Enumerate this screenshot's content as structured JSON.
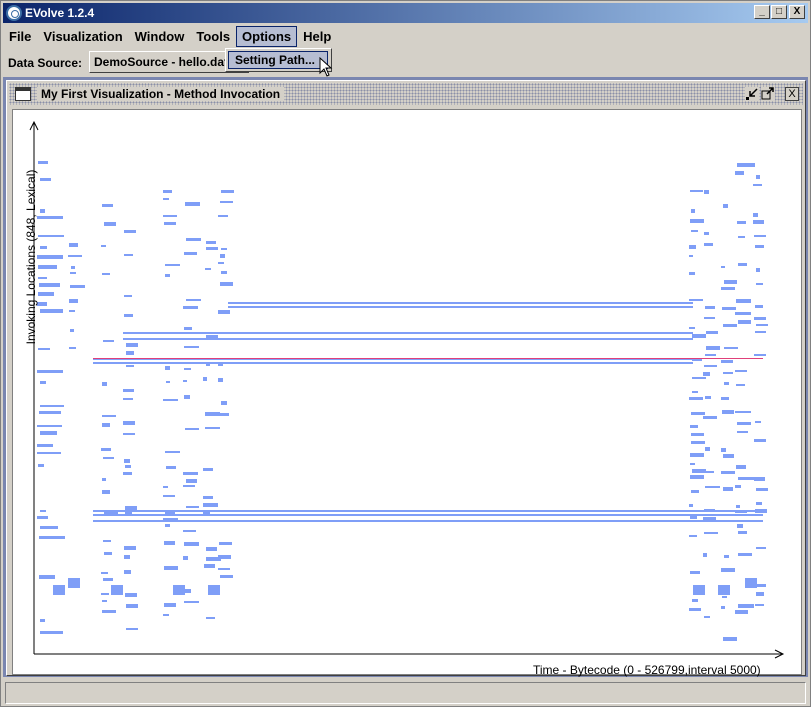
{
  "window": {
    "title": "EVolve 1.2.4",
    "min_glyph": "_",
    "max_glyph": "□",
    "close_glyph": "X"
  },
  "menu": {
    "file": "File",
    "visualization": "Visualization",
    "window": "Window",
    "tools": "Tools",
    "options": "Options",
    "help": "Help"
  },
  "options_menu": {
    "setting_path": "Setting Path..."
  },
  "toolbar": {
    "datasource_label": "Data Source:",
    "datasource_value": "DemoSource - hello.dat"
  },
  "frame": {
    "title": "My First Visualization - Method Invocation",
    "close_glyph": "X"
  },
  "plot": {
    "y_label": "Invoking Locations (848, Lexical)",
    "x_label": "Time - Bytecode (0 - 526799,interval 5000)"
  },
  "colors": {
    "mark": "#7f9ef7",
    "highlight": "#e0407a",
    "accent": "#0a246a"
  }
}
